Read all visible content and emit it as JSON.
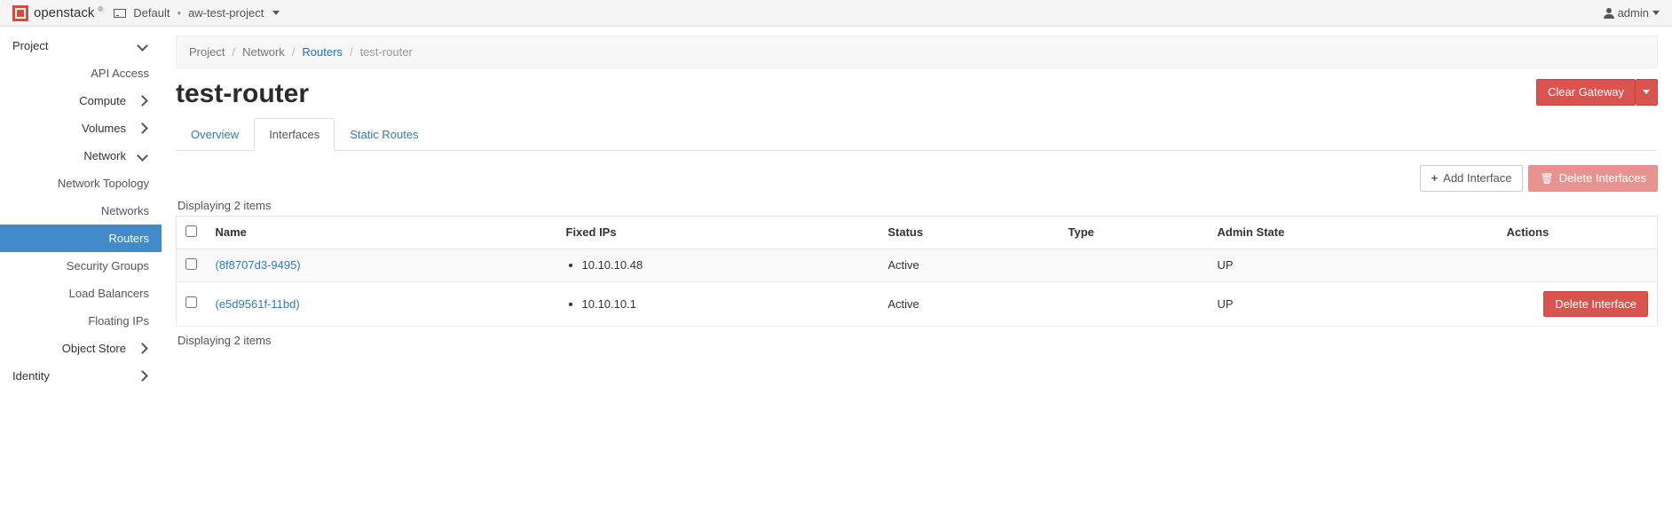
{
  "topbar": {
    "brand": "openstack",
    "domain_label": "Default",
    "project_label": "aw-test-project",
    "user_label": "admin"
  },
  "sidebar": {
    "project": {
      "label": "Project"
    },
    "api_access": "API Access",
    "compute": "Compute",
    "volumes": "Volumes",
    "network": "Network",
    "network_children": {
      "network_topology": "Network Topology",
      "networks": "Networks",
      "routers": "Routers",
      "security_groups": "Security Groups",
      "load_balancers": "Load Balancers",
      "floating_ips": "Floating IPs"
    },
    "object_store": "Object Store",
    "identity": "Identity"
  },
  "breadcrumb": {
    "project": "Project",
    "network": "Network",
    "routers": "Routers",
    "current": "test-router"
  },
  "page": {
    "title": "test-router",
    "clear_gateway": "Clear Gateway"
  },
  "tabs": {
    "overview": "Overview",
    "interfaces": "Interfaces",
    "static_routes": "Static Routes"
  },
  "toolbar": {
    "add_interface": "Add Interface",
    "delete_interfaces": "Delete Interfaces"
  },
  "table": {
    "count_text_top": "Displaying 2 items",
    "count_text_bottom": "Displaying 2 items",
    "headers": {
      "name": "Name",
      "fixed_ips": "Fixed IPs",
      "status": "Status",
      "type": "Type",
      "admin_state": "Admin State",
      "actions": "Actions"
    },
    "rows": [
      {
        "name": "(8f8707d3-9495)",
        "ip": "10.10.10.48",
        "status": "Active",
        "type": "",
        "admin_state": "UP",
        "action_label": ""
      },
      {
        "name": "(e5d9561f-11bd)",
        "ip": "10.10.10.1",
        "status": "Active",
        "type": "",
        "admin_state": "UP",
        "action_label": "Delete Interface"
      }
    ]
  }
}
